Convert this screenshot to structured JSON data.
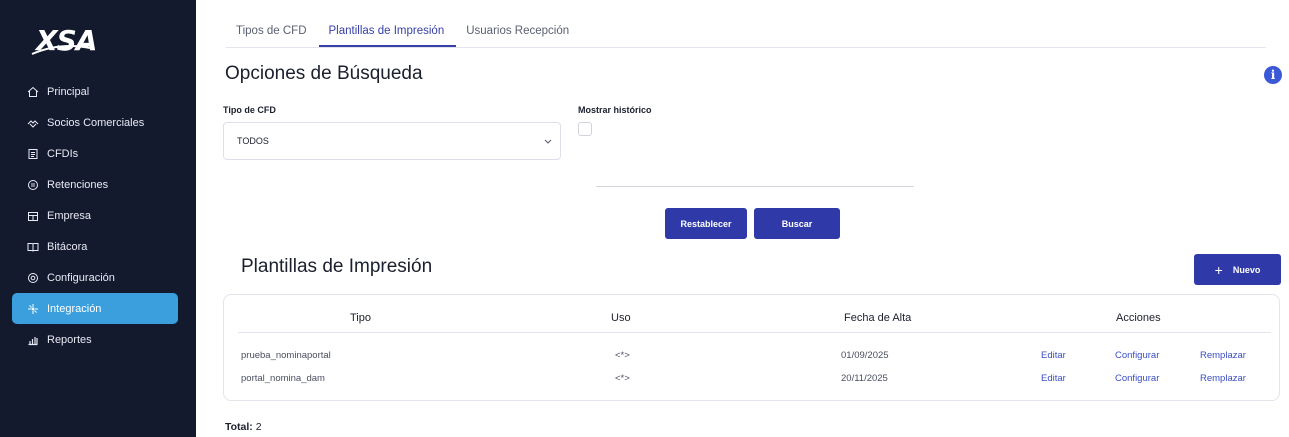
{
  "brand": {
    "logo_text": "XSA"
  },
  "sidebar": {
    "items": [
      {
        "label": "Principal",
        "icon": "home-icon"
      },
      {
        "label": "Socios Comerciales",
        "icon": "partners-icon"
      },
      {
        "label": "CFDIs",
        "icon": "document-icon"
      },
      {
        "label": "Retenciones",
        "icon": "retention-icon"
      },
      {
        "label": "Empresa",
        "icon": "building-icon"
      },
      {
        "label": "Bitácora",
        "icon": "book-icon"
      },
      {
        "label": "Configuración",
        "icon": "gear-icon"
      },
      {
        "label": "Integración",
        "icon": "integration-icon",
        "active": true
      },
      {
        "label": "Reportes",
        "icon": "chart-icon"
      }
    ]
  },
  "tabs": [
    {
      "label": "Tipos de CFD",
      "active": false
    },
    {
      "label": "Plantillas de Impresión",
      "active": true
    },
    {
      "label": "Usuarios Recepción",
      "active": false
    }
  ],
  "search": {
    "title": "Opciones de Búsqueda",
    "tipo_label": "Tipo de CFD",
    "tipo_value": "TODOS",
    "historico_label": "Mostrar histórico",
    "historico_checked": false,
    "reset_label": "Restablecer",
    "search_label": "Buscar"
  },
  "table": {
    "title": "Plantillas de Impresión",
    "new_label": "Nuevo",
    "headers": {
      "tipo": "Tipo",
      "uso": "Uso",
      "fecha": "Fecha de Alta",
      "acciones": "Acciones"
    },
    "rows": [
      {
        "tipo": "prueba_nominaportal",
        "uso": "<*>",
        "fecha": "01/09/2025",
        "editar": "Editar",
        "configurar": "Configurar",
        "remplazar": "Remplazar"
      },
      {
        "tipo": "portal_nomina_dam",
        "uso": "<*>",
        "fecha": "20/11/2025",
        "editar": "Editar",
        "configurar": "Configurar",
        "remplazar": "Remplazar"
      }
    ],
    "total_label": "Total:",
    "total_value": "2"
  },
  "colors": {
    "sidebar_bg": "#141a2e",
    "active_nav": "#3a9fdc",
    "primary_button": "#2f3aa8",
    "link": "#3b4ec2",
    "info_badge": "#3b58d6"
  }
}
